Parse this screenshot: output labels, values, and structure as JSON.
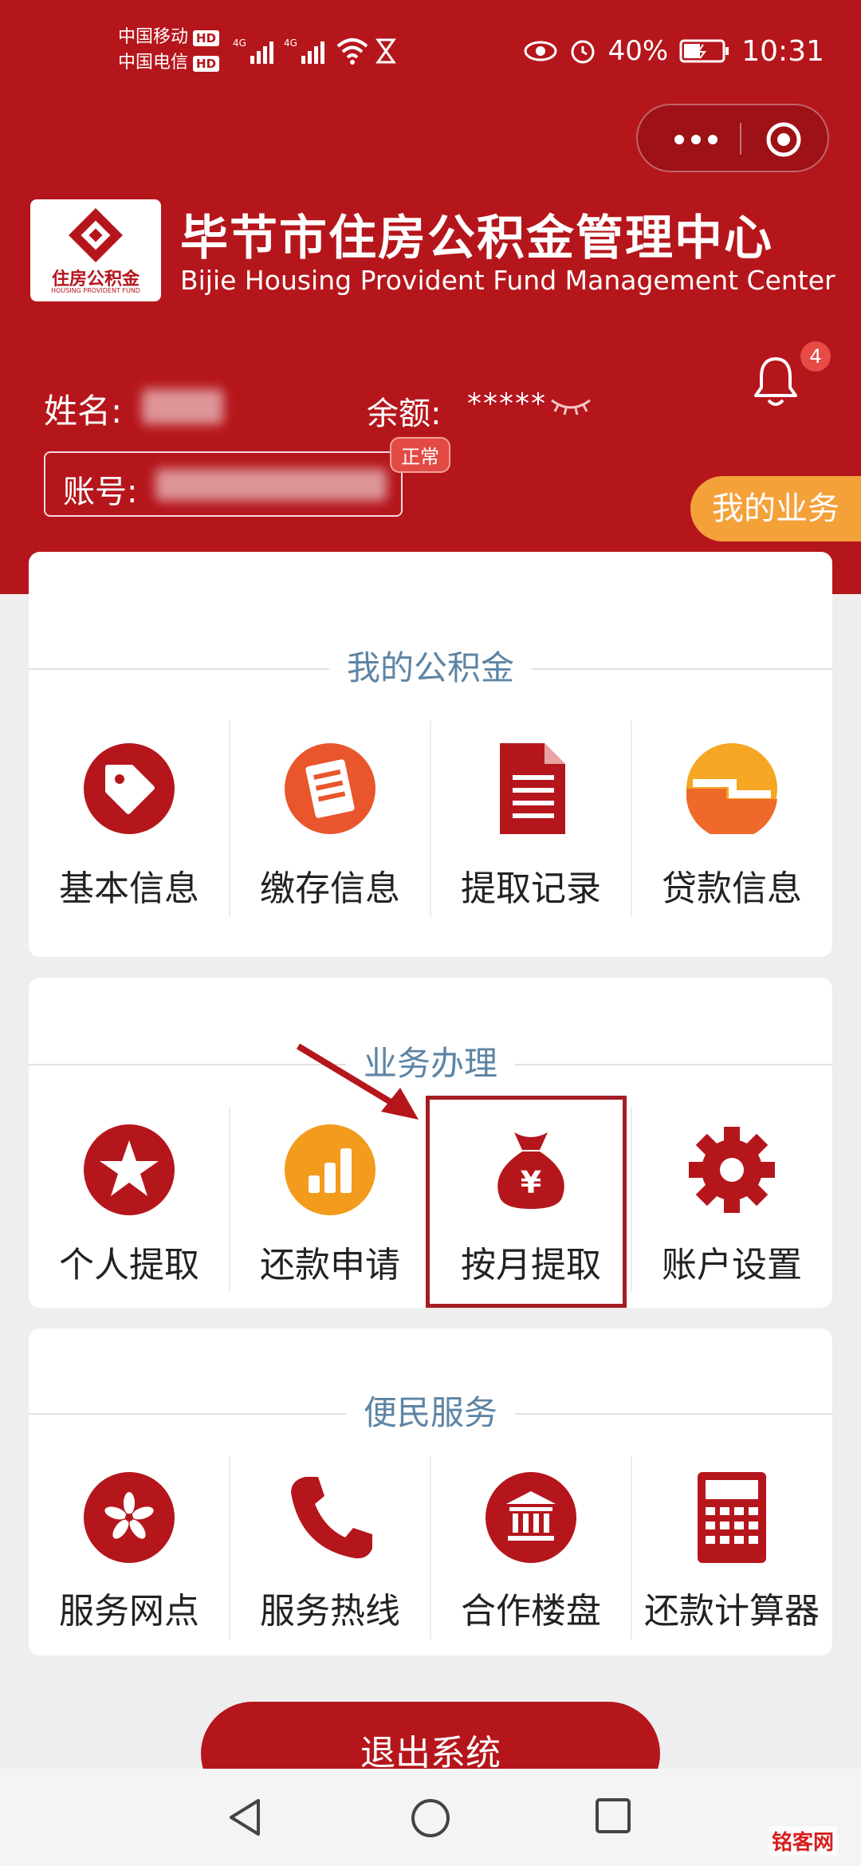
{
  "status_bar": {
    "carrier1": "中国移动",
    "carrier2": "中国电信",
    "hd": "HD",
    "net": "4G",
    "battery": "40%",
    "time": "10:31"
  },
  "header": {
    "logo_cn": "住房公积金",
    "logo_en": "HOUSING PROVIDENT FUND",
    "org_cn": "毕节市住房公积金管理中心",
    "org_en": "Bijie Housing Provident Fund Management Center",
    "notification_count": "4"
  },
  "user": {
    "name_label": "姓名:",
    "balance_label": "余额:",
    "balance_value": "*****",
    "account_label": "账号:",
    "account_status": "正常"
  },
  "my_business": "我的业务",
  "sections": [
    {
      "title": "我的公积金",
      "items": [
        {
          "label": "基本信息",
          "icon": "tag-icon"
        },
        {
          "label": "缴存信息",
          "icon": "document-list-icon"
        },
        {
          "label": "提取记录",
          "icon": "file-icon"
        },
        {
          "label": "贷款信息",
          "icon": "loan-icon"
        }
      ]
    },
    {
      "title": "业务办理",
      "items": [
        {
          "label": "个人提取",
          "icon": "star-icon"
        },
        {
          "label": "还款申请",
          "icon": "bar-chart-icon"
        },
        {
          "label": "按月提取",
          "icon": "money-bag-icon"
        },
        {
          "label": "账户设置",
          "icon": "gear-icon"
        }
      ]
    },
    {
      "title": "便民服务",
      "items": [
        {
          "label": "服务网点",
          "icon": "flower-icon"
        },
        {
          "label": "服务热线",
          "icon": "phone-icon"
        },
        {
          "label": "合作楼盘",
          "icon": "bank-icon"
        },
        {
          "label": "还款计算器",
          "icon": "calculator-icon"
        }
      ]
    }
  ],
  "logout": "退出系统",
  "watermark": "铭客网",
  "colors": {
    "brand_red": "#b5161c",
    "orange": "#f4a13a",
    "section_title": "#5d84a4"
  }
}
